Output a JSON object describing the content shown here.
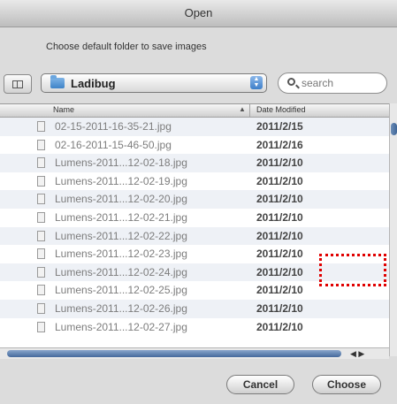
{
  "window": {
    "title": "Open"
  },
  "prompt": "Choose default folder to save images",
  "toolbar": {
    "folder": "Ladibug",
    "search_placeholder": "search"
  },
  "columns": {
    "name": "Name",
    "date": "Date Modified"
  },
  "files": [
    {
      "name": "02-15-2011-16-35-21.jpg",
      "date": "2011/2/15"
    },
    {
      "name": "02-16-2011-15-46-50.jpg",
      "date": "2011/2/16"
    },
    {
      "name": "Lumens-2011...12-02-18.jpg",
      "date": "2011/2/10"
    },
    {
      "name": "Lumens-2011...12-02-19.jpg",
      "date": "2011/2/10"
    },
    {
      "name": "Lumens-2011...12-02-20.jpg",
      "date": "2011/2/10"
    },
    {
      "name": "Lumens-2011...12-02-21.jpg",
      "date": "2011/2/10"
    },
    {
      "name": "Lumens-2011...12-02-22.jpg",
      "date": "2011/2/10"
    },
    {
      "name": "Lumens-2011...12-02-23.jpg",
      "date": "2011/2/10"
    },
    {
      "name": "Lumens-2011...12-02-24.jpg",
      "date": "2011/2/10"
    },
    {
      "name": "Lumens-2011...12-02-25.jpg",
      "date": "2011/2/10"
    },
    {
      "name": "Lumens-2011...12-02-26.jpg",
      "date": "2011/2/10"
    },
    {
      "name": "Lumens-2011...12-02-27.jpg",
      "date": "2011/2/10"
    }
  ],
  "buttons": {
    "cancel": "Cancel",
    "choose": "Choose"
  },
  "icons": {
    "view": "icon-view-toggle",
    "folder": "folder-icon",
    "search": "search-icon",
    "file": "image-file-icon"
  },
  "colors": {
    "highlight_marker": "#e00000",
    "accent": "#3e7fc9"
  }
}
